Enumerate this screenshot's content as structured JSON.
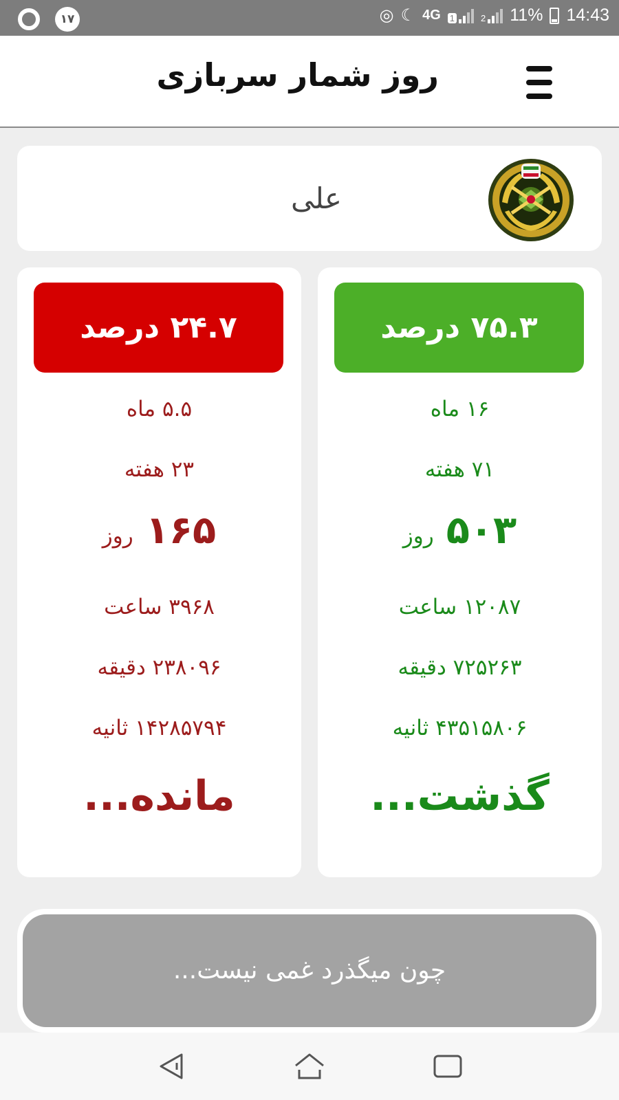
{
  "status_bar": {
    "notification_count": "۱۷",
    "network": "4G",
    "sim1_badge": "1",
    "sim2_badge": "2",
    "battery": "11%",
    "time": "14:43"
  },
  "app_bar": {
    "title": "روز شمار سربازی",
    "menu_icon": "hamburger-menu-icon"
  },
  "profile": {
    "name": "علی",
    "emblem_icon": "army-emblem"
  },
  "remaining": {
    "percent_label": "۲۴.۷ درصد",
    "months": "۵.۵ ماه",
    "weeks": "۲۳ هفته",
    "days_value": "۱۶۵",
    "days_unit": "روز",
    "hours": "۳۹۶۸ ساعت",
    "minutes": "۲۳۸۰۹۶ دقیقه",
    "seconds": "۱۴۲۸۵۷۹۴ ثانیه",
    "footer": "مانده...",
    "color": "#9c1c1c",
    "badge_color": "#d50000"
  },
  "passed": {
    "percent_label": "۷۵.۳ درصد",
    "months": "۱۶ ماه",
    "weeks": "۷۱ هفته",
    "days_value": "۵۰۳",
    "days_unit": "روز",
    "hours": "۱۲۰۸۷ ساعت",
    "minutes": "۷۲۵۲۶۳ دقیقه",
    "seconds": "۴۳۵۱۵۸۰۶ ثانیه",
    "footer": "گذشت...",
    "color": "#1a8a1a",
    "badge_color": "#4caf28"
  },
  "quote": "چون میگذرد غمی نیست...",
  "nav_bar": {
    "back_icon": "back-triangle-icon",
    "home_icon": "home-icon",
    "recents_icon": "recents-square-icon"
  }
}
